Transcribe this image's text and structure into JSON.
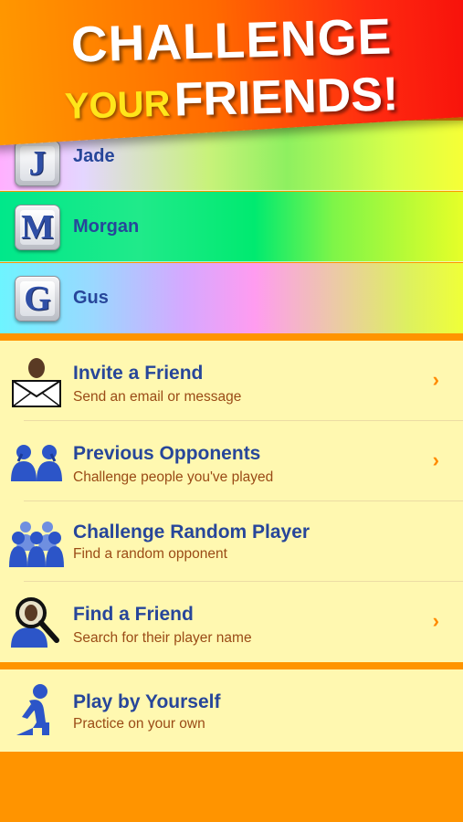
{
  "banner": {
    "line1": "CHALLENGE",
    "line2_a": "YOUR",
    "line2_b": "FRIENDS!"
  },
  "friends": [
    {
      "letter": "J",
      "name": "Jade"
    },
    {
      "letter": "M",
      "name": "Morgan"
    },
    {
      "letter": "G",
      "name": "Gus"
    }
  ],
  "menu": [
    {
      "title": "Invite a Friend",
      "subtitle": "Send an email or message",
      "icon": "envelope-person-icon",
      "chevron": "›"
    },
    {
      "title": "Previous Opponents",
      "subtitle": "Challenge people you've played",
      "icon": "people-pair-icon",
      "chevron": "›"
    },
    {
      "title": "Challenge Random Player",
      "subtitle": "Find a random opponent",
      "icon": "crowd-icon",
      "chevron": ""
    },
    {
      "title": "Find a Friend",
      "subtitle": "Search for their player name",
      "icon": "magnifier-person-icon",
      "chevron": "›"
    }
  ],
  "solo": {
    "title": "Play by Yourself",
    "subtitle": "Practice on your own",
    "icon": "sitting-person-icon"
  },
  "colors": {
    "accent": "#ff9400",
    "title": "#27469a",
    "subtitle": "#9a4b16",
    "panel": "#fff8b0",
    "icon": "#2c55c8"
  }
}
